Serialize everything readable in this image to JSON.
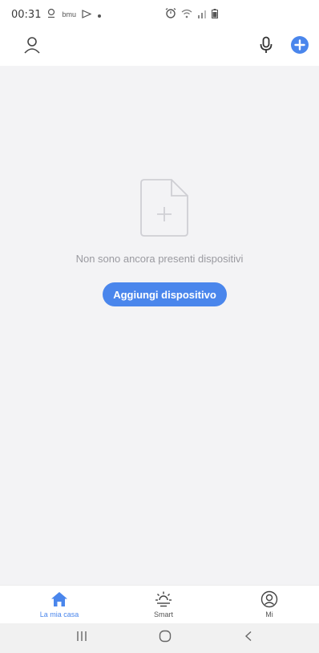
{
  "status_bar": {
    "time": "00:31",
    "mini_label": "bmu"
  },
  "empty_state": {
    "message": "Non sono ancora presenti dispositivi",
    "add_button_label": "Aggiungi dispositivo"
  },
  "tabs": [
    {
      "label": "La mia casa",
      "icon": "home-icon",
      "active": true
    },
    {
      "label": "Smart",
      "icon": "sun-icon",
      "active": false
    },
    {
      "label": "Mi",
      "icon": "user-circle-icon",
      "active": false
    }
  ],
  "colors": {
    "accent": "#4a86ec",
    "background": "#f3f3f5",
    "muted_text": "#9a9aa0"
  },
  "header": {
    "icons": [
      "profile-icon",
      "microphone-icon",
      "add-circle-icon"
    ]
  },
  "nav_bar": {
    "icons": [
      "recents-icon",
      "home-nav-icon",
      "back-icon"
    ]
  }
}
